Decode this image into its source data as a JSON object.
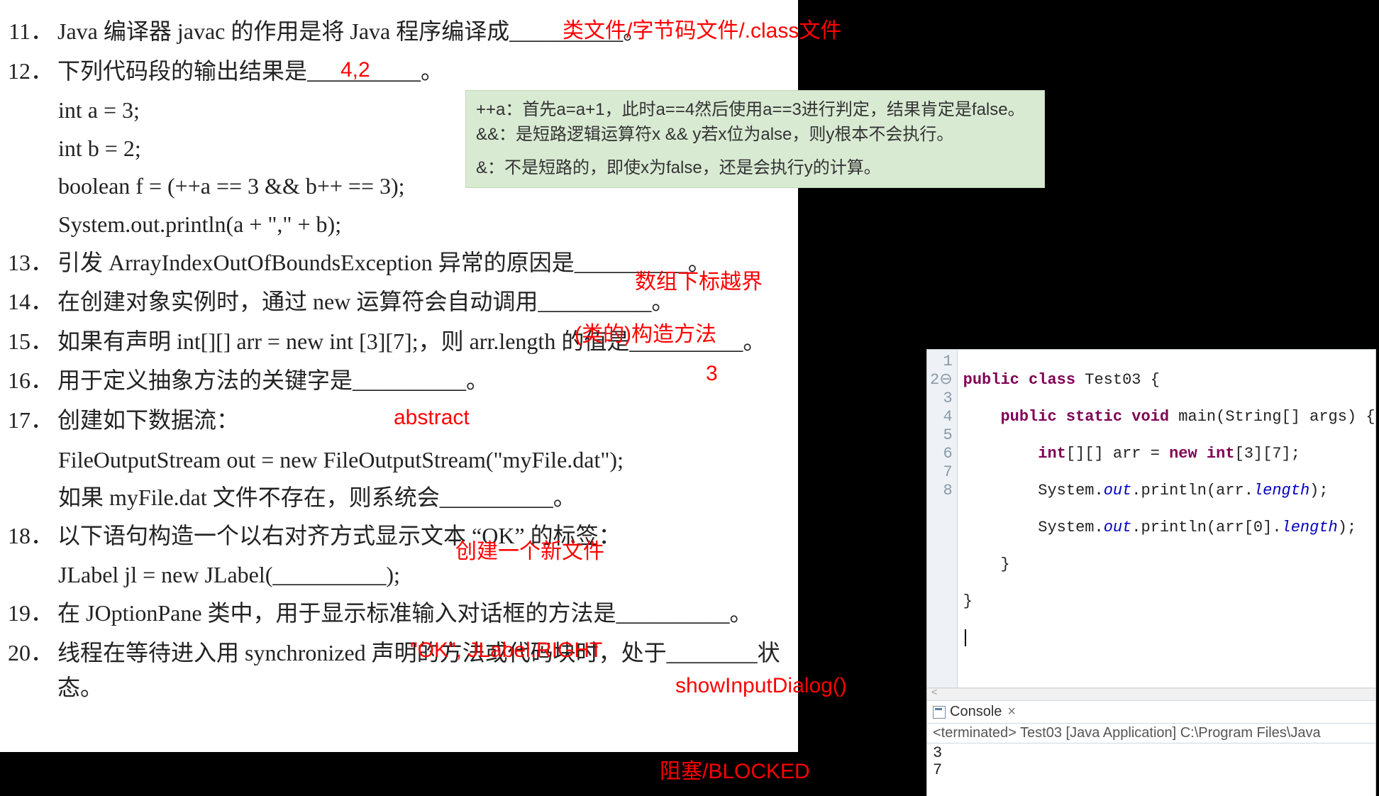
{
  "questions": {
    "q11": {
      "num": "11．",
      "text": "Java 编译器 javac 的作用是将 Java 程序编译成__________。"
    },
    "q12": {
      "num": "12．",
      "text": "下列代码段的输出结果是__________。",
      "code": [
        "int a = 3;",
        "int b = 2;",
        "boolean f = (++a == 3 && b++ == 3);",
        "System.out.println(a + \",\" + b);"
      ]
    },
    "q13": {
      "num": "13．",
      "text": "引发 ArrayIndexOutOfBoundsException 异常的原因是__________。"
    },
    "q14": {
      "num": "14．",
      "text": "在创建对象实例时，通过 new 运算符会自动调用__________。"
    },
    "q15": {
      "num": "15．",
      "text": "如果有声明 int[][] arr = new int [3][7];，则 arr.length 的值是__________。"
    },
    "q16": {
      "num": "16．",
      "text": "用于定义抽象方法的关键字是__________。"
    },
    "q17": {
      "num": "17．",
      "text": "创建如下数据流：",
      "code": [
        "FileOutputStream out = new FileOutputStream(\"myFile.dat\");"
      ],
      "tail": "如果 myFile.dat 文件不存在，则系统会__________。"
    },
    "q18": {
      "num": "18．",
      "text": "以下语句构造一个以右对齐方式显示文本 “OK” 的标签：",
      "code": [
        "JLabel jl = new JLabel(__________);"
      ]
    },
    "q19": {
      "num": "19．",
      "text": "在 JOptionPane 类中，用于显示标准输入对话框的方法是__________。"
    },
    "q20": {
      "num": "20．",
      "text": "线程在等待进入用 synchronized 声明的方法或代码块时，处于________状态。"
    }
  },
  "answers": {
    "a11": "类文件/字节码文件/.class文件",
    "a12": "4,2",
    "a13": "数组下标越界",
    "a14": "(类的)构造方法",
    "a15": "3",
    "a16": "abstract",
    "a17": "创建一个新文件",
    "a18": "\"OK\", JLabel.RIGHT",
    "a19": "showInputDialog()",
    "a20": "阻塞/BLOCKED"
  },
  "explain": {
    "l1": "++a：首先a=a+1，此时a==4然后使用a==3进行判定，结果肯定是false。",
    "l2": "&&：是短路逻辑运算符x && y若x位为alse，则y根本不会执行。",
    "l3": "&：不是短路的，即使x为false，还是会执行y的计算。"
  },
  "ide": {
    "gutter": [
      "1",
      "2⊖",
      "3",
      "4",
      "5",
      "6",
      "7",
      "8"
    ],
    "src": {
      "l1a": "public",
      "l1b": " class",
      "l1c": " Test03 {",
      "l2a": "    public",
      "l2b": " static",
      "l2c": " void",
      "l2d": " main(String[] args) {",
      "l3a": "        int",
      "l3b": "[][] arr = ",
      "l3c": "new",
      "l3d": " int",
      "l3e": "[3][7];",
      "l4a": "        System.",
      "l4b": "out",
      "l4c": ".println(arr.",
      "l4d": "length",
      "l4e": ");",
      "l5a": "        System.",
      "l5b": "out",
      "l5c": ".println(arr[0].",
      "l5d": "length",
      "l5e": ");",
      "l6": "    }",
      "l7": "}"
    },
    "consoleTab": "Console",
    "terminated": "<terminated> Test03 [Java Application] C:\\Program Files\\Java",
    "output": "3\n7"
  }
}
